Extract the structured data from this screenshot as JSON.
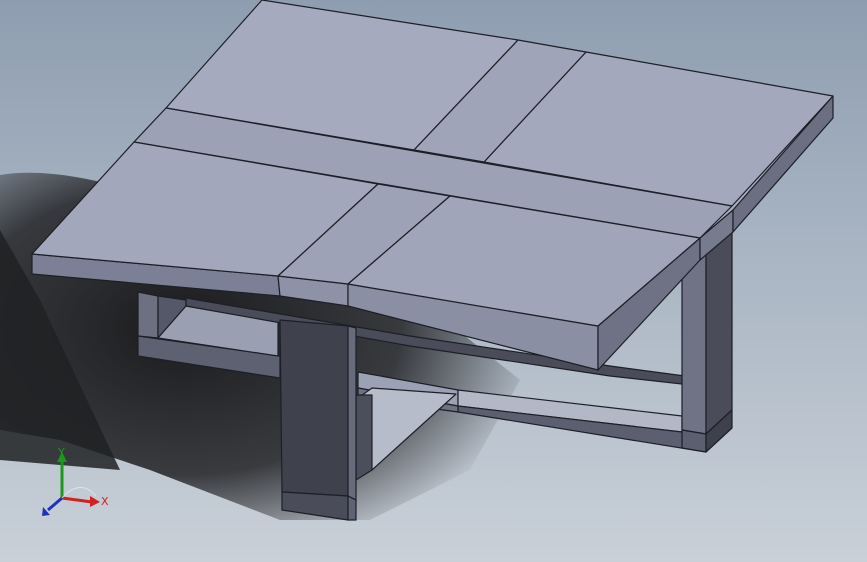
{
  "viewport": {
    "model": "square-coffee-table",
    "view": "isometric",
    "colors": {
      "background_top": "#8e9db0",
      "background_bottom": "#c9d0d8",
      "top_face": "#9ea3b8",
      "top_face_light": "#a9aec2",
      "side_face": "#7c8096",
      "leg_dark": "#3f424d",
      "leg_mid": "#676b7c",
      "shadow": "#222325",
      "edge": "#1c1f27"
    }
  },
  "triad": {
    "x_label": "X",
    "y_label": "Y",
    "x_color": "#d02020",
    "y_color": "#1a9a1a",
    "z_color": "#2030c0"
  }
}
